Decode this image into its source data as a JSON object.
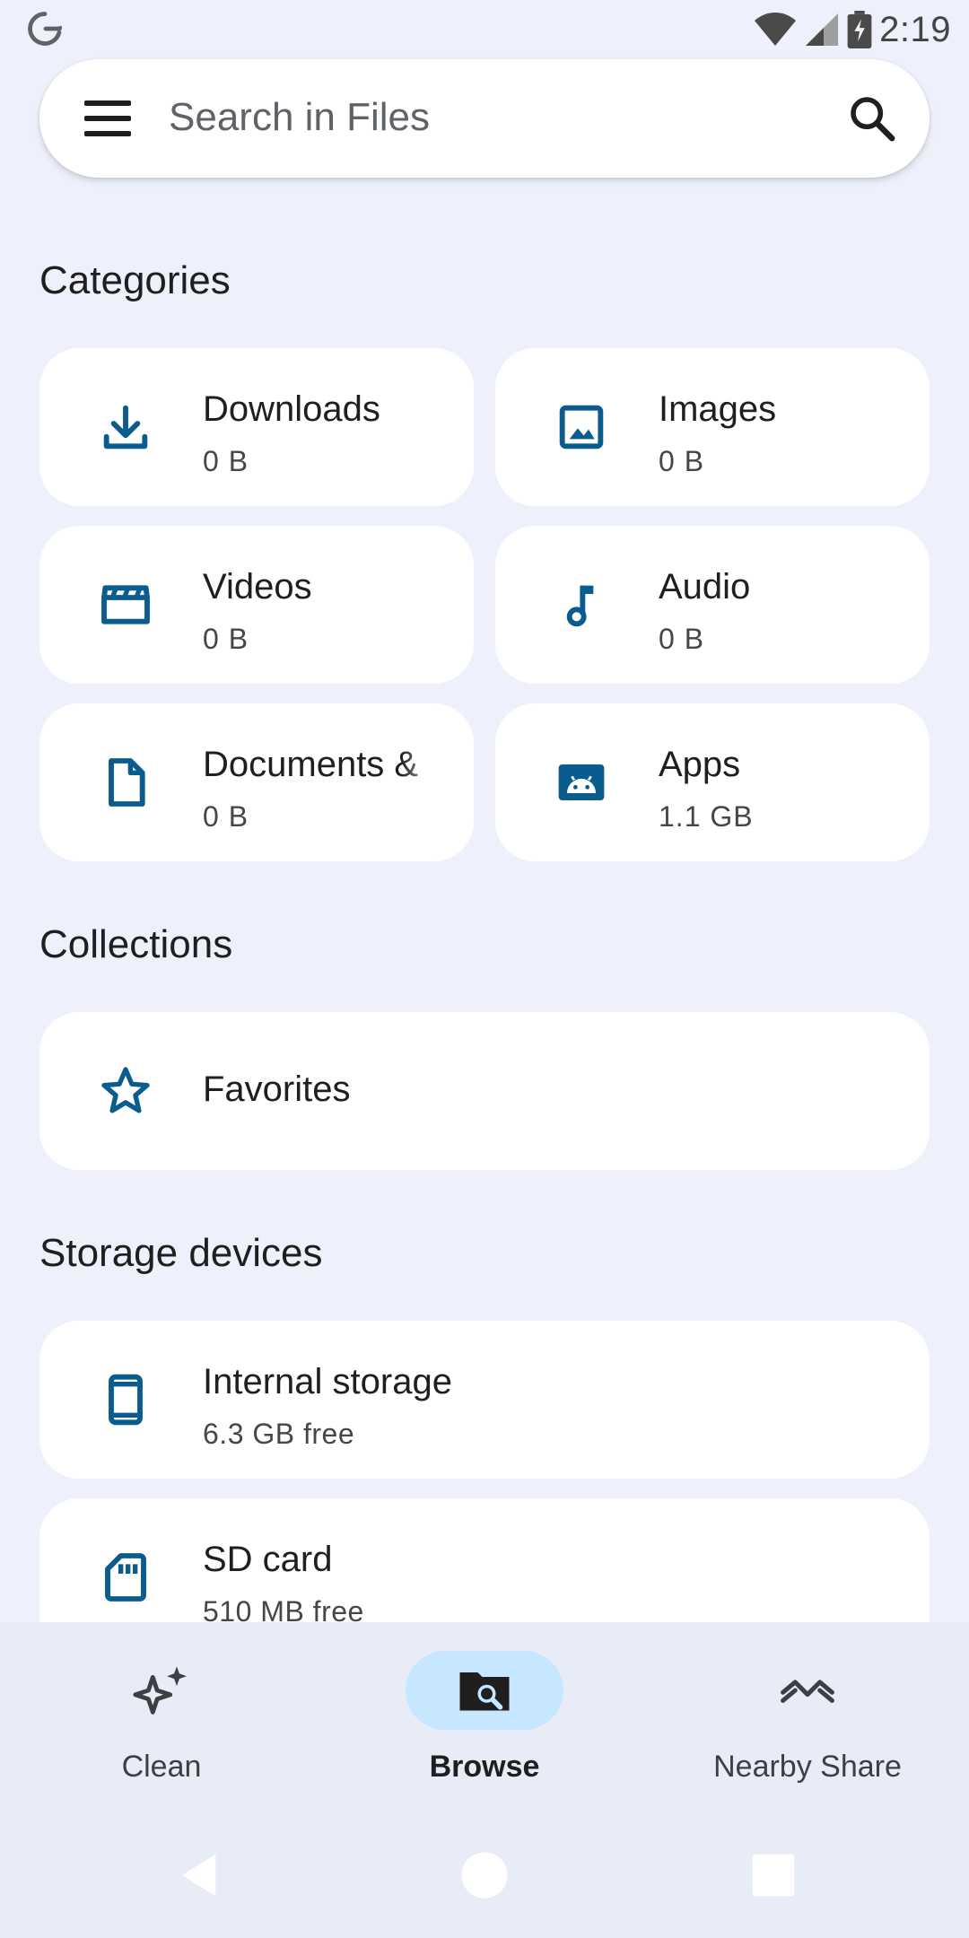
{
  "status_bar": {
    "time": "2:19",
    "icons": [
      "google-g-icon",
      "wifi-icon",
      "cellular-signal-icon",
      "battery-charging-icon"
    ]
  },
  "search": {
    "placeholder": "Search in Files"
  },
  "sections": {
    "categories_title": "Categories",
    "collections_title": "Collections",
    "storage_title": "Storage devices"
  },
  "categories": [
    {
      "label": "Downloads",
      "size": "0 B",
      "icon": "download-icon"
    },
    {
      "label": "Images",
      "size": "0 B",
      "icon": "image-icon"
    },
    {
      "label": "Videos",
      "size": "0 B",
      "icon": "movie-icon"
    },
    {
      "label": "Audio",
      "size": "0 B",
      "icon": "music-note-icon"
    },
    {
      "label": "Documents &",
      "size": "0 B",
      "icon": "document-icon"
    },
    {
      "label": "Apps",
      "size": "1.1 GB",
      "icon": "android-icon"
    }
  ],
  "collections": [
    {
      "label": "Favorites",
      "icon": "star-icon"
    }
  ],
  "storage": [
    {
      "label": "Internal storage",
      "free": "6.3 GB free",
      "icon": "phone-icon"
    },
    {
      "label": "SD card",
      "free": "510 MB free",
      "icon": "sd-card-icon"
    }
  ],
  "bottom_nav": {
    "items": [
      {
        "label": "Clean",
        "icon": "sparkle-icon",
        "active": false
      },
      {
        "label": "Browse",
        "icon": "folder-search-icon",
        "active": true
      },
      {
        "label": "Nearby Share",
        "icon": "nearby-share-icon",
        "active": false
      }
    ]
  },
  "colors": {
    "accent": "#0b5c8e",
    "background": "#eef1fb",
    "card": "#ffffff",
    "active_pill": "#c6e7ff"
  }
}
